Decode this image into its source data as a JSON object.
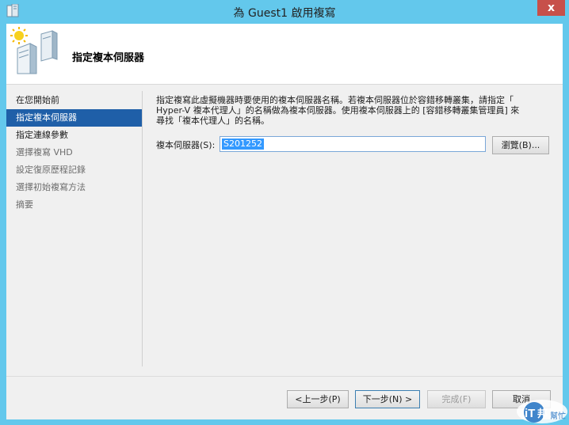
{
  "window": {
    "title": "為 Guest1 啟用複寫",
    "close_glyph": "x"
  },
  "header": {
    "page_title": "指定複本伺服器"
  },
  "steps": [
    {
      "label": "在您開始前",
      "state": "normal"
    },
    {
      "label": "指定複本伺服器",
      "state": "active"
    },
    {
      "label": "指定連線參數",
      "state": "normal"
    },
    {
      "label": "選擇複寫 VHD",
      "state": "disabled"
    },
    {
      "label": "設定復原歷程記錄",
      "state": "disabled"
    },
    {
      "label": "選擇初始複寫方法",
      "state": "disabled"
    },
    {
      "label": "摘要",
      "state": "disabled"
    }
  ],
  "content": {
    "description_lines": [
      "指定複寫此虛擬機器時要使用的複本伺服器名稱。若複本伺服器位於容錯移轉叢集，請指定「",
      "Hyper-V 複本代理人」的名稱做為複本伺服器。使用複本伺服器上的 [容錯移轉叢集管理員] 來",
      "尋找「複本代理人」的名稱。"
    ],
    "server_label": "複本伺服器(S):",
    "server_value": "S201252",
    "browse_button": "瀏覽(B)..."
  },
  "footer": {
    "back_button": "<上一步(P)",
    "next_button": "下一步(N) >",
    "finish_button": "完成(F)",
    "cancel_button": "取消"
  },
  "watermark": {
    "text_a": "iT",
    "text_b": "邦",
    "text_c": "幫忙"
  },
  "colors": {
    "frame": "#63c8ec",
    "selection": "#1f5fa8",
    "input_selection": "#3399ff",
    "close_button": "#c7504a"
  }
}
